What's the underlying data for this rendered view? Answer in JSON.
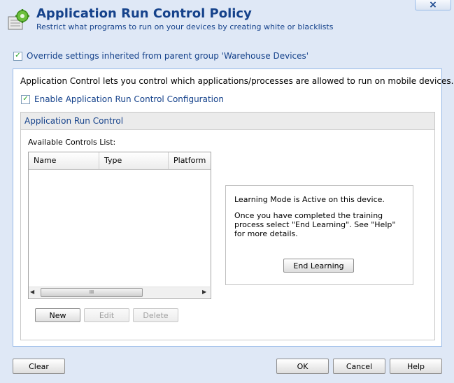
{
  "header": {
    "title": "Application Run Control Policy",
    "subtitle": "Restrict what programs to run on your devices by creating white or blacklists",
    "close_label": "×"
  },
  "override": {
    "label": "Override settings inherited from parent group 'Warehouse Devices'",
    "checked": true
  },
  "main": {
    "description": "Application Control lets you control which applications/processes are allowed to run on mobile devices.",
    "enable_label": "Enable Application Run Control Configuration",
    "enable_checked": true,
    "panel_title": "Application Run Control",
    "list_label": "Available Controls List:",
    "columns": [
      "Name",
      "Type",
      "Platform"
    ],
    "rows": [],
    "scroll_grip": "III",
    "buttons": {
      "new": "New",
      "edit": "Edit",
      "delete": "Delete"
    },
    "learning": {
      "status": "Learning Mode is Active on this device.",
      "instructions": "Once you have completed the training process select \"End Learning\". See \"Help\" for more details.",
      "end_button": "End Learning"
    }
  },
  "footer": {
    "clear": "Clear",
    "ok": "OK",
    "cancel": "Cancel",
    "help": "Help"
  },
  "colors": {
    "accent": "#15428b",
    "background": "#dfe8f6",
    "border": "#99bbe8",
    "check": "#21a121"
  },
  "icons": {
    "app": "gear-grid-icon",
    "close": "close-icon",
    "check": "checkmark-icon"
  }
}
